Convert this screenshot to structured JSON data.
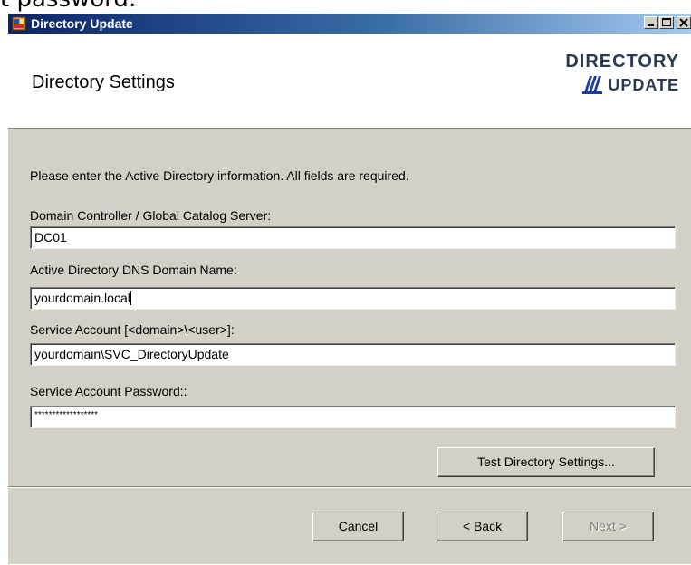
{
  "background": {
    "caption": "t password:"
  },
  "window": {
    "title": "Directory Update"
  },
  "header": {
    "title": "Directory Settings",
    "logo_line1": "Directory",
    "logo_line2": "Update"
  },
  "form": {
    "intro": "Please enter the Active Directory information. All fields are required.",
    "fields": [
      {
        "label": "Domain Controller / Global Catalog Server:",
        "value": "DC01"
      },
      {
        "label": "Active Directory DNS Domain Name:",
        "value": "yourdomain.local"
      },
      {
        "label": "Service Account  [<domain>\\<user>]:",
        "value": "yourdomain\\SVC_DirectoryUpdate"
      },
      {
        "label": "Service Account Password::",
        "value": "******************"
      }
    ]
  },
  "buttons": {
    "test": "Test Directory Settings...",
    "cancel": "Cancel",
    "back": "< Back",
    "next": "Next >"
  },
  "colors": {
    "title_bar": "#0a246a",
    "dialog_bg": "#d4d0c8",
    "logo": "#2b3a52"
  },
  "icons": [
    "app-icon",
    "minimize-icon",
    "maximize-icon",
    "close-icon",
    "books-logo-icon"
  ]
}
